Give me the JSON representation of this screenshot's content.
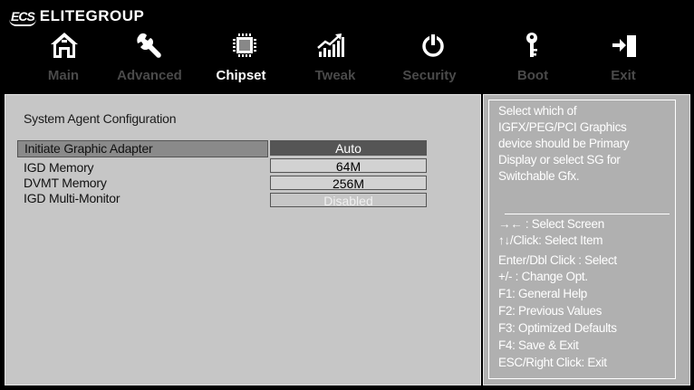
{
  "brand": {
    "mark": "ECS",
    "name": "ELITEGROUP"
  },
  "nav": {
    "tabs": [
      {
        "label": "Main",
        "icon": "home-icon"
      },
      {
        "label": "Advanced",
        "icon": "wrench-icon"
      },
      {
        "label": "Chipset",
        "icon": "chip-icon"
      },
      {
        "label": "Tweak",
        "icon": "performance-chart-icon"
      },
      {
        "label": "Security",
        "icon": "power-icon"
      },
      {
        "label": "Boot",
        "icon": "key-icon"
      },
      {
        "label": "Exit",
        "icon": "exit-icon"
      }
    ],
    "active_tab": "Chipset"
  },
  "main": {
    "section_title": "System Agent Configuration",
    "settings": [
      {
        "label": "Initiate Graphic Adapter",
        "value": "Auto",
        "selected": true
      },
      {
        "label": "IGD Memory",
        "value": "64M"
      },
      {
        "label": "DVMT Memory",
        "value": "256M"
      },
      {
        "label": "IGD Multi-Monitor",
        "value": "Disabled",
        "disabled": true
      }
    ]
  },
  "help": {
    "description": [
      "Select which of",
      "IGFX/PEG/PCI Graphics",
      "device should be Primary",
      "Display or select SG for",
      "Switchable Gfx."
    ],
    "keys": [
      "→←  : Select Screen",
      "↑↓/Click: Select Item",
      "Enter/Dbl Click : Select",
      "+/- : Change Opt.",
      "F1: General Help",
      "F2: Previous Values",
      "F3: Optimized Defaults",
      "F4: Save & Exit",
      "ESC/Right Click: Exit"
    ]
  },
  "colors": {
    "background": "#000000",
    "panel": "#c6c6c6",
    "help_panel": "#b0b0b0",
    "selected_value": "#555555",
    "inactive_tab": "#4a4a4a",
    "active_tab": "#ffffff"
  }
}
